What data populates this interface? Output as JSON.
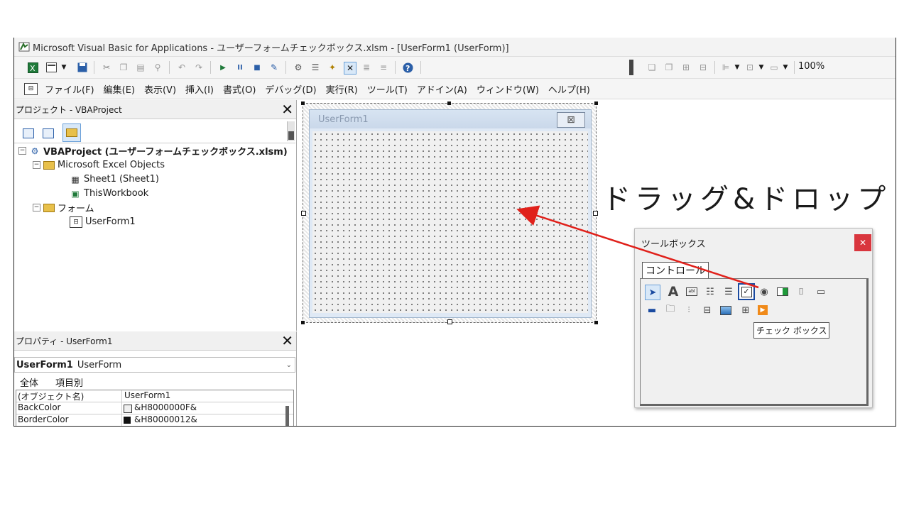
{
  "window": {
    "title": "Microsoft Visual Basic for Applications - ユーザーフォームチェックボックス.xlsm - [UserForm1 (UserForm)]"
  },
  "toolbar": {
    "zoom": "100%"
  },
  "menu": {
    "items": [
      "ファイル(F)",
      "編集(E)",
      "表示(V)",
      "挿入(I)",
      "書式(O)",
      "デバッグ(D)",
      "実行(R)",
      "ツール(T)",
      "アドイン(A)",
      "ウィンドウ(W)",
      "ヘルプ(H)"
    ]
  },
  "project": {
    "title": "プロジェクト - VBAProject",
    "tree": [
      "VBAProject (ユーザーフォームチェックボックス.xlsm)",
      "Microsoft Excel Objects",
      "Sheet1 (Sheet1)",
      "ThisWorkbook",
      "フォーム",
      "UserForm1"
    ]
  },
  "properties": {
    "title": "プロパティ - UserForm1",
    "object_name": "UserForm1",
    "object_type": "UserForm",
    "tabs": [
      "全体",
      "項目別"
    ],
    "rows": [
      {
        "name": "(オブジェクト名)",
        "value": "UserForm1"
      },
      {
        "name": "BackColor",
        "value": "&H8000000F&"
      },
      {
        "name": "BorderColor",
        "value": "&H80000012&"
      }
    ]
  },
  "userform": {
    "caption": "UserForm1"
  },
  "annotation": {
    "text": "ドラッグ&ドロップ",
    "arrow_color": "#e0201a"
  },
  "toolbox": {
    "title": "ツールボックス",
    "tab": "コントロール",
    "tooltip": "チェック ボックス"
  }
}
